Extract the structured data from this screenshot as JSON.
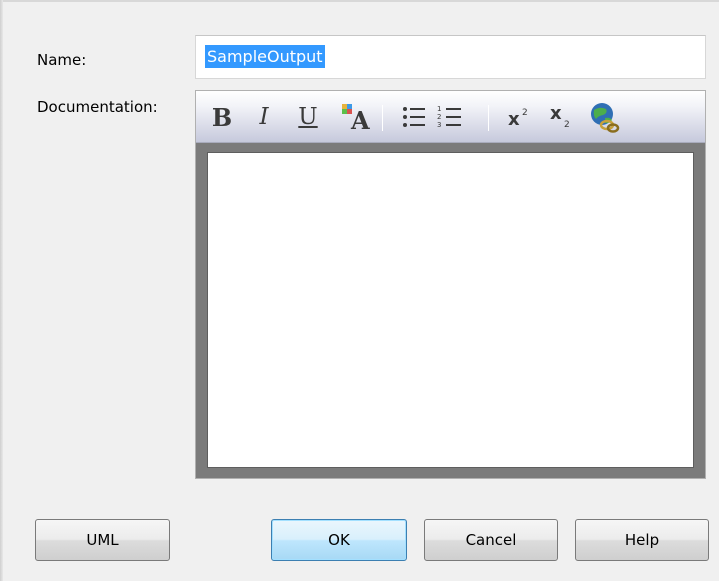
{
  "labels": {
    "name": "Name:",
    "documentation": "Documentation:"
  },
  "name_field": {
    "value": "SampleOutput",
    "selected": true
  },
  "editor": {
    "toolbar": [
      {
        "id": "bold",
        "icon": "bold-icon",
        "label": "B"
      },
      {
        "id": "italic",
        "icon": "italic-icon",
        "label": "I"
      },
      {
        "id": "underline",
        "icon": "underline-icon",
        "label": "U"
      },
      {
        "id": "font",
        "icon": "font-color-icon",
        "label": "A"
      },
      {
        "id": "bullets",
        "icon": "bulleted-list-icon"
      },
      {
        "id": "numbering",
        "icon": "numbered-list-icon"
      },
      {
        "id": "superscript",
        "icon": "superscript-icon"
      },
      {
        "id": "subscript",
        "icon": "subscript-icon"
      },
      {
        "id": "hyperlink",
        "icon": "hyperlink-globe-icon"
      }
    ],
    "content": ""
  },
  "buttons": {
    "uml": "UML",
    "ok": "OK",
    "cancel": "Cancel",
    "help": "Help"
  },
  "colors": {
    "selection": "#3399ff",
    "default_button_border": "#3c7fb1",
    "dialog_background": "#f0f0f0"
  }
}
